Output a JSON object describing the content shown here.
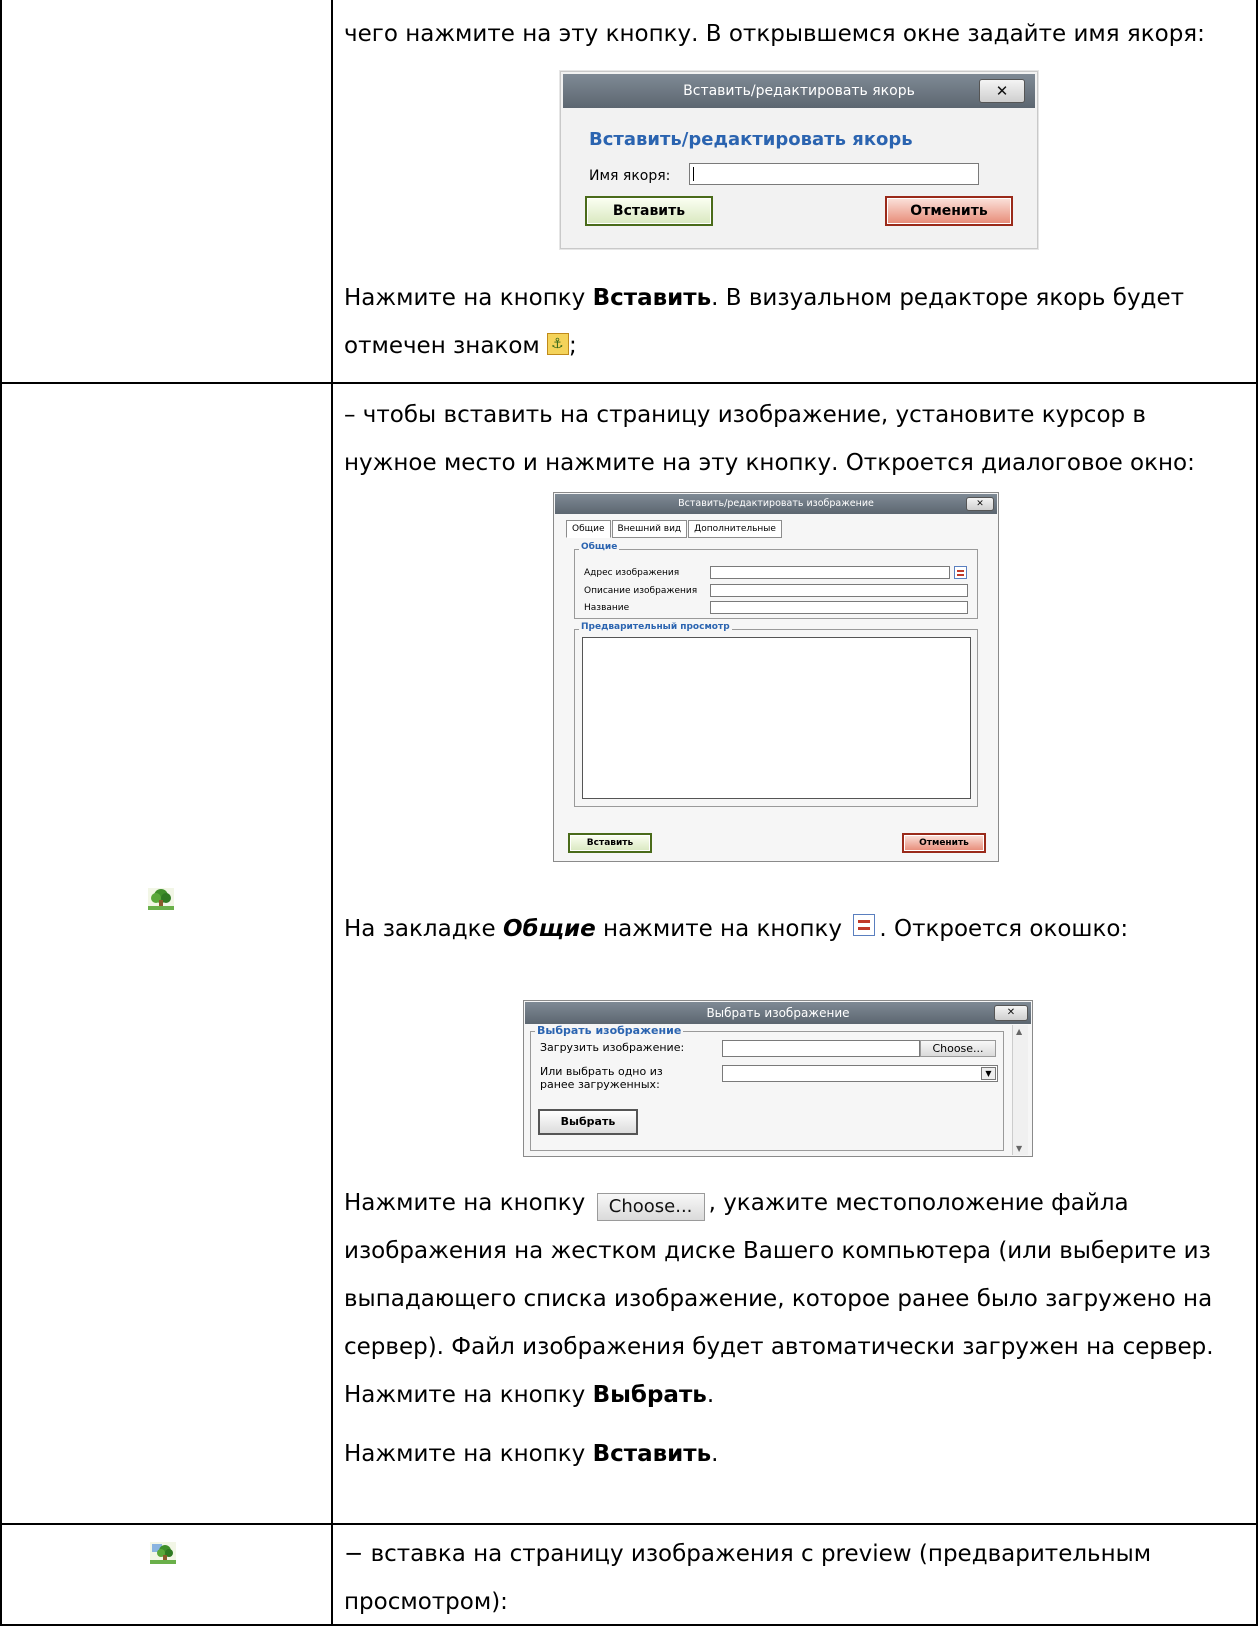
{
  "rows": {
    "anchor": {
      "line1": "чего нажмите на эту кнопку. В открывшемся окне задайте имя якоря:",
      "after_line1_pre": "Нажмите на кнопку ",
      "after_line1_bold": "Вставить",
      "after_line1_post": ". В визуальном редакторе якорь будет",
      "after_line2_pre": "отмечен знаком ",
      "after_line2_post": ";"
    },
    "image": {
      "line1": "– чтобы вставить на страницу изображение, установите курсор в",
      "line2": "нужное место и нажмите на эту кнопку. Откроется диалоговое окно:",
      "tab_line_pre": "На закладке ",
      "tab_line_bold": "Общие",
      "tab_line_mid": " нажмите на кнопку ",
      "tab_line_post": ". Откроется окошко:",
      "choose_line_pre": "Нажмите на кнопку ",
      "choose_line_post": ", укажите местоположение файла",
      "p_line2": "изображения на жестком диске Вашего компьютера (или выберите из",
      "p_line3": "выпадающего списка изображение, которое ранее было загружено на",
      "p_line4": "сервер). Файл изображения будет автоматически загружен на сервер.",
      "p_line5_pre": "Нажмите на кнопку ",
      "p_line5_bold": "Выбрать",
      "p_line5_post": ".",
      "p_line6_pre": "Нажмите на кнопку ",
      "p_line6_bold": "Вставить",
      "p_line6_post": "."
    },
    "preview": {
      "line1": "− вставка на страницу изображения с preview (предварительным",
      "line2": "просмотром):"
    }
  },
  "anchor_dialog": {
    "title": "Вставить/редактировать якорь",
    "heading": "Вставить/редактировать якорь",
    "label": "Имя якоря:",
    "input_value": "",
    "insert": "Вставить",
    "cancel": "Отменить",
    "close": "✕"
  },
  "image_dialog": {
    "title": "Вставить/редактировать изображение",
    "tabs": [
      "Общие",
      "Внешний вид",
      "Дополнительные"
    ],
    "legend_general": "Общие",
    "field_url": "Адрес изображения",
    "field_desc": "Описание изображения",
    "field_title": "Название",
    "legend_preview": "Предварительный просмотр",
    "insert": "Вставить",
    "cancel": "Отменить",
    "close": "✕"
  },
  "select_dialog": {
    "title": "Выбрать изображение",
    "legend": "Выбрать изображение",
    "upload_label": "Загрузить изображение:",
    "choose_btn": "Choose...",
    "or_label_1": "Или выбрать одно из",
    "or_label_2": "ранее загруженных:",
    "select_btn": "Выбрать",
    "close": "✕"
  },
  "inline": {
    "choose": "Choose..."
  },
  "icons": {
    "tree": "tree-image-icon",
    "tree_preview": "tree-preview-icon",
    "anchor": "anchor-icon",
    "browse": "browse-icon"
  }
}
